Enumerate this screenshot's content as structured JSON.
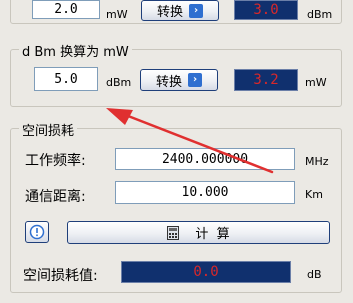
{
  "top_row": {
    "input_value": "2.0",
    "input_unit": "mW",
    "convert_label": "转换",
    "output_value": "3.0",
    "output_unit": "dBm"
  },
  "dbm_to_mw": {
    "title": "d Bm 换算为 mW",
    "input_value": "5.0",
    "input_unit": "dBm",
    "convert_label": "转换",
    "output_value": "3.2",
    "output_unit": "mW"
  },
  "path_loss": {
    "title": "空间损耗",
    "frequency_label": "工作频率:",
    "frequency_value": "2400.000000",
    "frequency_unit": "MHz",
    "distance_label": "通信距离:",
    "distance_value": "10.000",
    "distance_unit": "Km",
    "calculate_label": "计  算",
    "result_label": "空间损耗值:",
    "result_value": "0.0",
    "result_unit": "dB"
  },
  "colors": {
    "display_bg": "#10306e",
    "display_text": "#d8282a",
    "annotation_arrow": "#e03030",
    "button_accent": "#2f6fd0"
  },
  "icons": {
    "convert_button_icon": "chevron-right-icon",
    "calculate_button_icon": "calculator-icon",
    "info_button_icon": "help-icon"
  }
}
